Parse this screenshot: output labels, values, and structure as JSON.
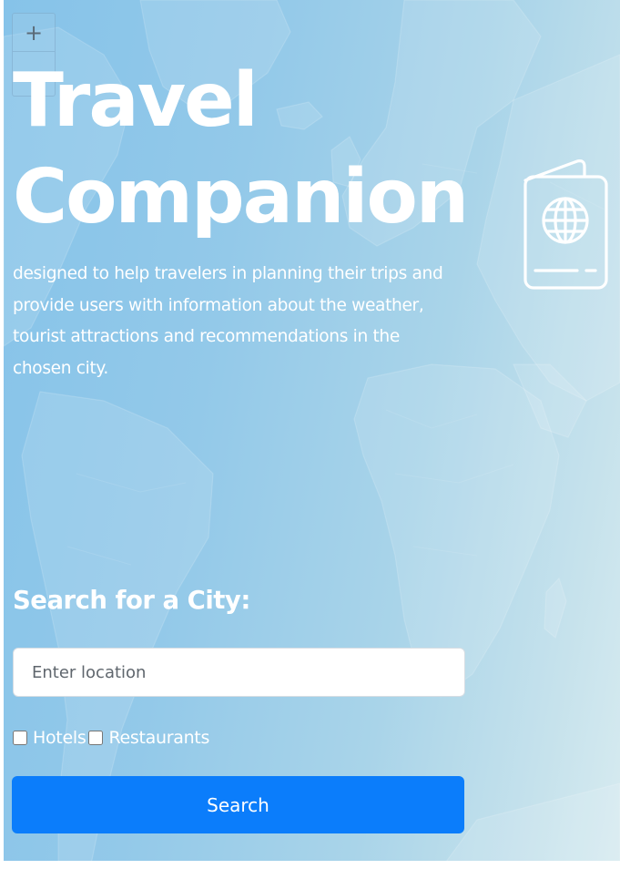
{
  "map": {
    "zoom_in_label": "+"
  },
  "hero": {
    "title_line_1": "Travel",
    "title_line_2": "Companion",
    "description": "designed to help travelers in planning their trips and provide users with information about the weather, tourist attractions and recommendations in the chosen city."
  },
  "search": {
    "heading": "Search for a City:",
    "placeholder": "Enter location",
    "value": "",
    "filters": [
      {
        "label": "Hotels",
        "checked": false
      },
      {
        "label": "Restaurants",
        "checked": false
      }
    ],
    "button_label": "Search"
  },
  "icons": {
    "map_background": "world-map",
    "passport": "passport-globe-icon"
  },
  "colors": {
    "button": "#0b7dfb",
    "map_water": "#93c9e9",
    "text": "#ffffff"
  }
}
